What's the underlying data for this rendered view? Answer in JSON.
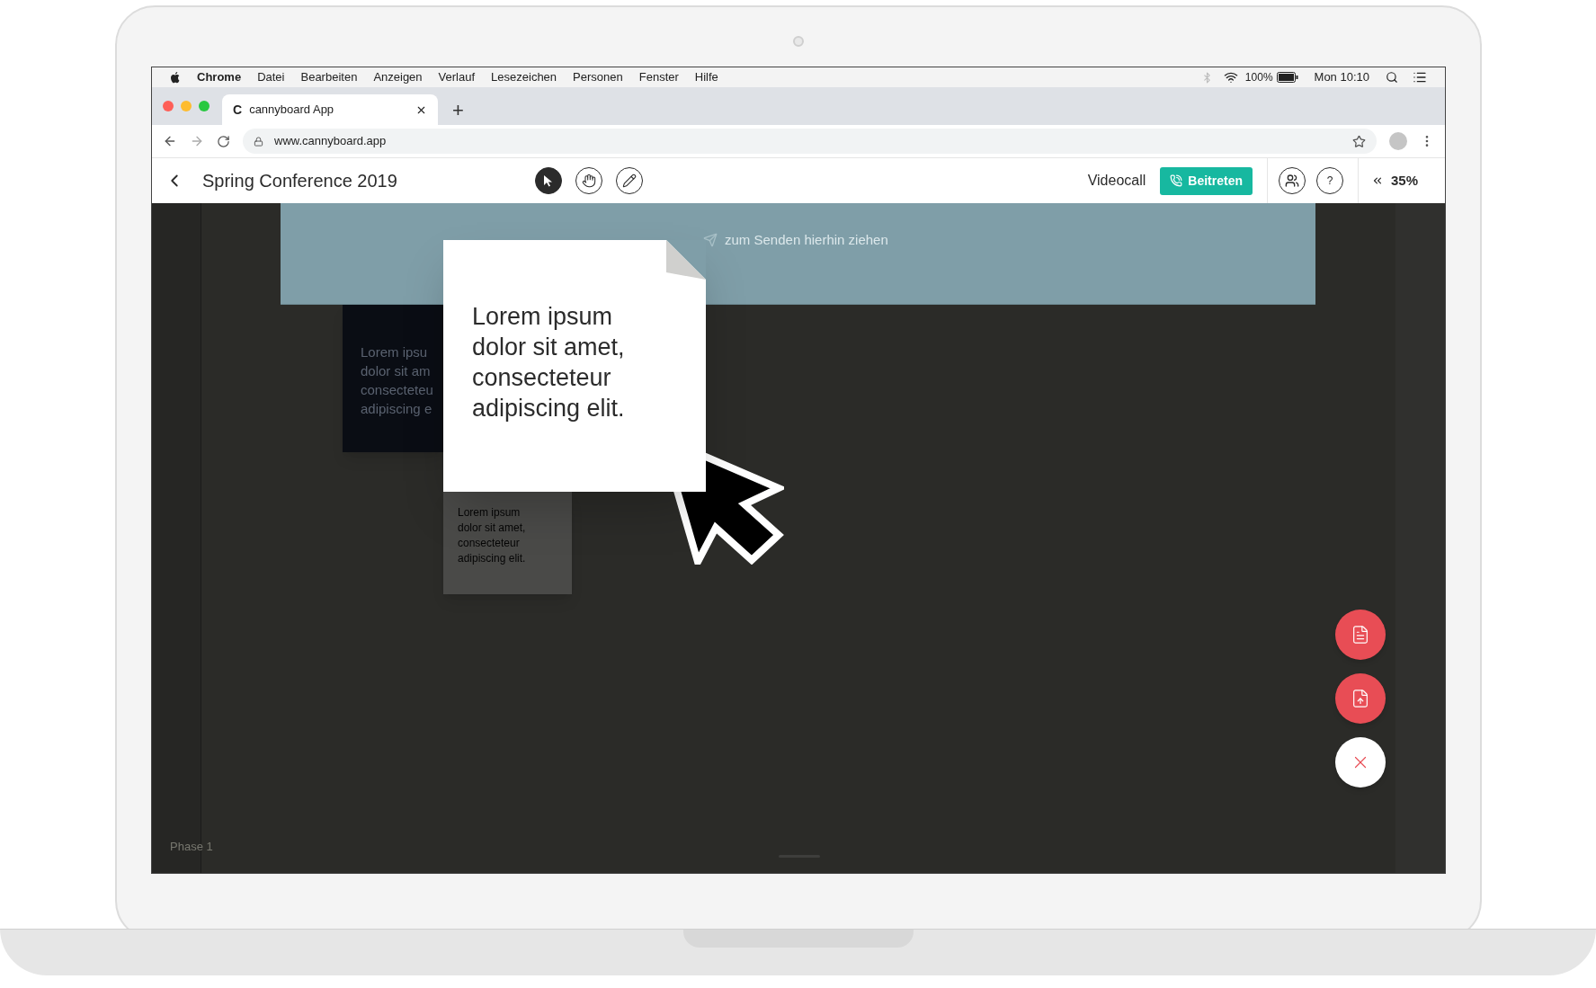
{
  "menu_bar": {
    "app": "Chrome",
    "items": [
      "Datei",
      "Bearbeiten",
      "Anzeigen",
      "Verlauf",
      "Lesezeichen",
      "Personen",
      "Fenster",
      "Hilfe"
    ],
    "battery": "100%",
    "clock": "Mon 10:10"
  },
  "browser": {
    "tab": {
      "title": "cannyboard App",
      "favicon": "C"
    },
    "new_tab": "+",
    "url": "www.cannyboard.app"
  },
  "header": {
    "title": "Spring Conference 2019",
    "tools": [
      {
        "kind": "pointer",
        "selected": true
      },
      {
        "kind": "hand",
        "selected": false
      },
      {
        "kind": "pen",
        "selected": false
      }
    ],
    "videocall_label": "Videocall",
    "join_button": "Beitreten",
    "help": "?",
    "zoom": "35%"
  },
  "board": {
    "drop_zone": "zum Senden hierhin ziehen",
    "notes": [
      {
        "kind": "dark",
        "lines": [
          "Lorem ipsu",
          "dolor sit am",
          "consecteteu",
          "adipiscing e"
        ]
      },
      {
        "kind": "dragged",
        "lines": [
          "Lorem ipsum",
          "dolor sit amet,",
          "consecteteur",
          "adipiscing elit."
        ]
      },
      {
        "kind": "gray",
        "lines": [
          "Lorem ipsum",
          "dolor sit amet,",
          "consecteteur",
          "adipiscing elit."
        ]
      }
    ],
    "phase": "Phase 1"
  },
  "actions": [
    {
      "kind": "note"
    },
    {
      "kind": "upload"
    },
    {
      "kind": "close"
    }
  ]
}
